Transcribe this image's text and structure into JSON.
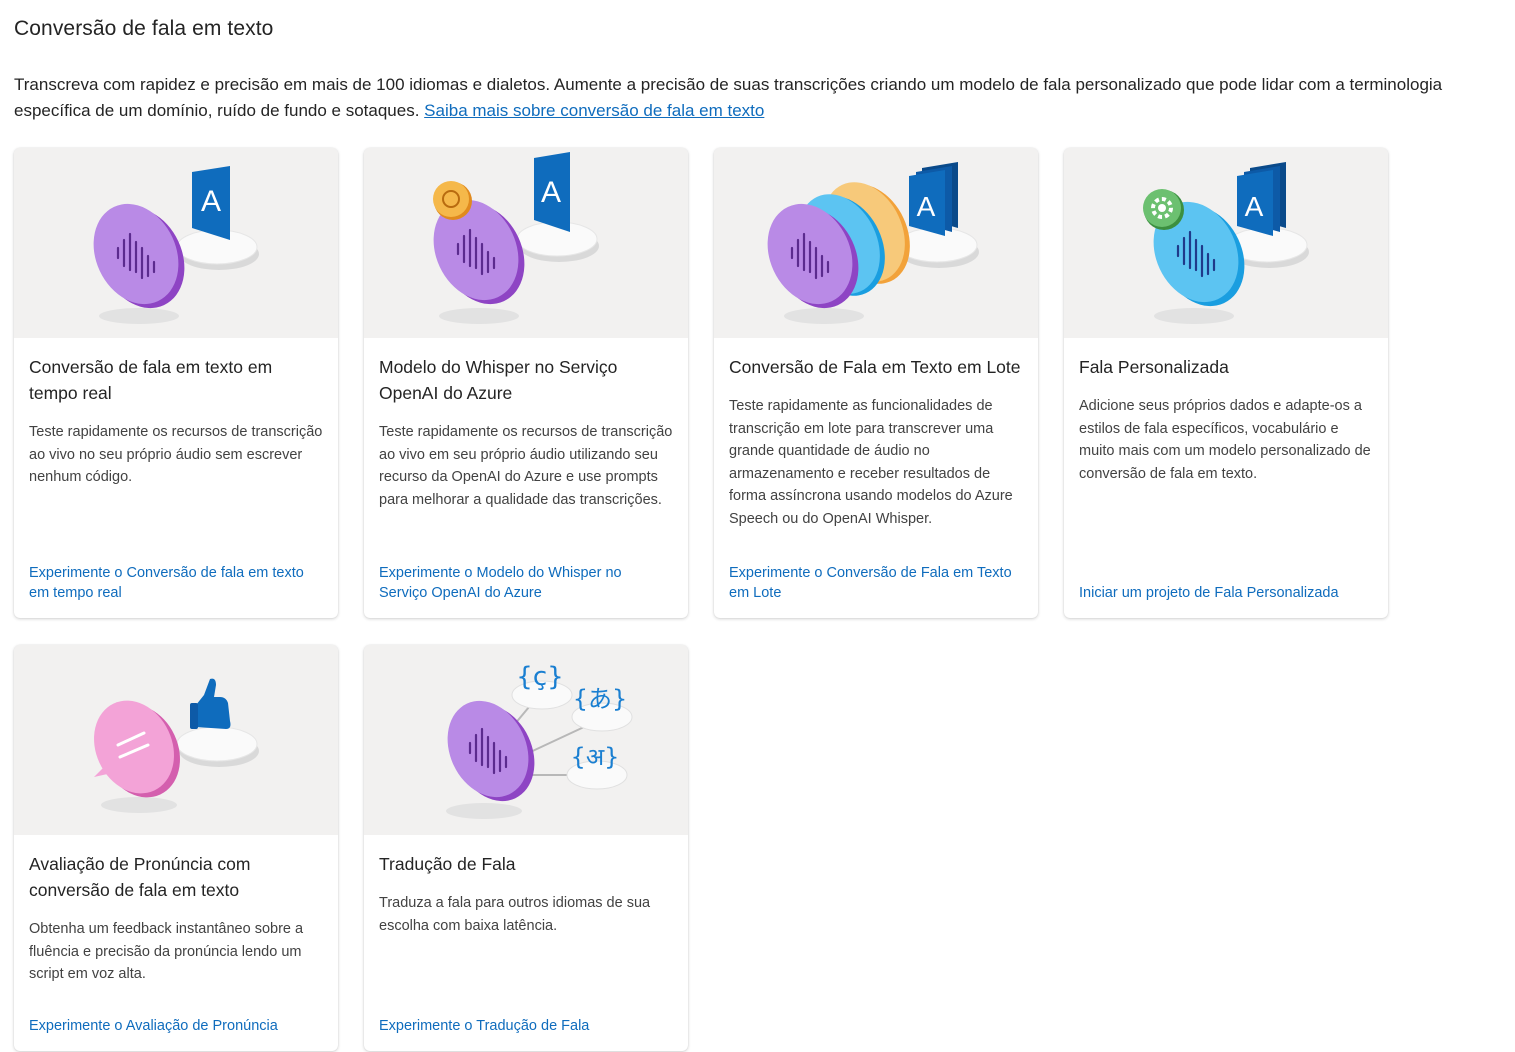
{
  "page": {
    "title": "Conversão de fala em texto",
    "intro": "Transcreva com rapidez e precisão em mais de 100 idiomas e dialetos. Aumente a precisão de suas transcrições criando um modelo de fala personalizado que pode lidar com a terminologia específica de um domínio, ruído de fundo e sotaques.",
    "intro_link": "Saiba mais sobre conversão de fala em texto"
  },
  "cards": [
    {
      "title": "Conversão de fala em texto em tempo real",
      "description": "Teste rapidamente os recursos de transcrição ao vivo no seu próprio áudio sem escrever nenhum código.",
      "link": "Experimente o Conversão de fala em texto em tempo real",
      "icon": "purple-speech-disc-to-text-icon"
    },
    {
      "title": "Modelo do Whisper no Serviço OpenAI do Azure",
      "description": "Teste rapidamente os recursos de transcrição ao vivo em seu próprio áudio utilizando seu recurso da OpenAI do Azure e use prompts para melhorar a qualidade das transcrições.",
      "link": "Experimente o Modelo do Whisper no Serviço OpenAI do Azure",
      "icon": "openai-whisper-speech-icon"
    },
    {
      "title": "Conversão de Fala em Texto em Lote",
      "description": "Teste rapidamente as funcionalidades de transcrição em lote para transcrever uma grande quantidade de áudio no armazenamento e receber resultados de forma assíncrona usando modelos do Azure Speech ou do OpenAI Whisper.",
      "link": "Experimente o Conversão de Fala em Texto em Lote",
      "icon": "batch-speech-discs-icon"
    },
    {
      "title": "Fala Personalizada",
      "description": "Adicione seus próprios dados e adapte-os a estilos de fala específicos, vocabulário e muito mais com um modelo personalizado de conversão de fala em texto.",
      "link": "Iniciar um projeto de Fala Personalizada",
      "icon": "custom-speech-gear-icon"
    },
    {
      "title": "Avaliação de Pronúncia com conversão de fala em texto",
      "description": "Obtenha um feedback instantâneo sobre a fluência e precisão da pronúncia lendo um script em voz alta.",
      "link": "Experimente o Avaliação de Pronúncia",
      "icon": "pronunciation-thumbs-up-icon"
    },
    {
      "title": "Tradução de Fala",
      "description": "Traduza a fala para outros idiomas de sua escolha com baixa latência.",
      "link": "Experimente o Tradução de Fala",
      "icon": "speech-translation-icon",
      "glyphs": [
        "{ç}",
        "{あ}",
        "{अ}"
      ]
    }
  ],
  "colors": {
    "link": "#0f6cbd",
    "hero_background": "#f2f1f0",
    "purple": "#a15ad8",
    "blue": "#0f6cbd",
    "orange": "#f2a23a",
    "sky": "#3fb6ee",
    "pink": "#e880c4",
    "green": "#4caf50"
  },
  "static_glyphs": {
    "letter_a": "A"
  }
}
